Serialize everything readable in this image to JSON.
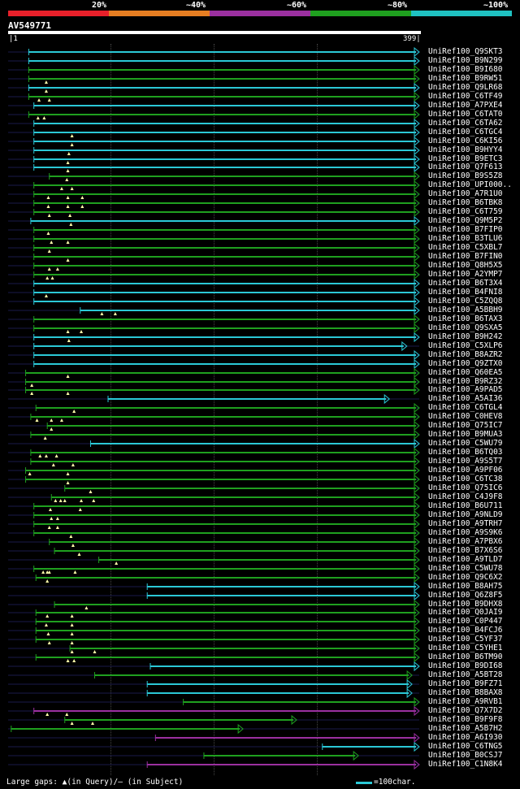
{
  "legend": [
    {
      "label": "20%",
      "color": "#e8202a"
    },
    {
      "label": "~40%",
      "color": "#e67e22"
    },
    {
      "label": "~60%",
      "color": "#9b30a0"
    },
    {
      "label": "~80%",
      "color": "#1fa01f"
    },
    {
      "label": "~100%",
      "color": "#1fc1c1"
    }
  ],
  "query": {
    "id": "AV549771",
    "start": "1",
    "end": "399"
  },
  "colors": {
    "cyan": "#2bc8d6",
    "green": "#1fa01f",
    "purple": "#9b30a0",
    "query_dim": "#1a1a4a",
    "gap_marker": "#ffffaa"
  },
  "hits": [
    {
      "label": "UniRef100_Q9SKT3",
      "color": "cyan",
      "start": 20,
      "end": 399,
      "qgap": []
    },
    {
      "label": "UniRef100_B9N299",
      "color": "cyan",
      "start": 20,
      "end": 399,
      "qgap": []
    },
    {
      "label": "UniRef100_B9I680",
      "color": "green",
      "start": 20,
      "end": 399,
      "qgap": []
    },
    {
      "label": "UniRef100_B9RW51",
      "color": "green",
      "start": 20,
      "end": 399,
      "qgap": [
        37
      ]
    },
    {
      "label": "UniRef100_Q9LR68",
      "color": "cyan",
      "start": 20,
      "end": 399,
      "qgap": [
        37
      ]
    },
    {
      "label": "UniRef100_C6TF49",
      "color": "green",
      "start": 20,
      "end": 399,
      "qgap": [
        30,
        40
      ]
    },
    {
      "label": "UniRef100_A7PXE4",
      "color": "cyan",
      "start": 25,
      "end": 399,
      "qgap": []
    },
    {
      "label": "UniRef100_C6TAT0",
      "color": "green",
      "start": 20,
      "end": 399,
      "qgap": [
        29,
        35
      ]
    },
    {
      "label": "UniRef100_C6TA62",
      "color": "cyan",
      "start": 25,
      "end": 399,
      "qgap": []
    },
    {
      "label": "UniRef100_C6TGC4",
      "color": "cyan",
      "start": 25,
      "end": 399,
      "qgap": [
        62
      ]
    },
    {
      "label": "UniRef100_C6KI56",
      "color": "cyan",
      "start": 25,
      "end": 399,
      "qgap": [
        62
      ]
    },
    {
      "label": "UniRef100_B9HYY4",
      "color": "cyan",
      "start": 25,
      "end": 399,
      "qgap": [
        59
      ]
    },
    {
      "label": "UniRef100_B9ETC3",
      "color": "cyan",
      "start": 25,
      "end": 399,
      "qgap": [
        58
      ]
    },
    {
      "label": "UniRef100_Q7F613",
      "color": "cyan",
      "start": 25,
      "end": 399,
      "qgap": [
        58
      ]
    },
    {
      "label": "UniRef100_B9S5Z8",
      "color": "green",
      "start": 40,
      "end": 399,
      "qgap": [
        57
      ]
    },
    {
      "label": "UniRef100_UPI000..",
      "color": "green",
      "start": 25,
      "end": 399,
      "qgap": [
        52,
        62
      ]
    },
    {
      "label": "UniRef100_A7R1U0",
      "color": "green",
      "start": 25,
      "end": 399,
      "qgap": [
        39,
        58,
        72
      ]
    },
    {
      "label": "UniRef100_B6TBK8",
      "color": "green",
      "start": 25,
      "end": 399,
      "qgap": [
        39,
        58,
        72
      ]
    },
    {
      "label": "UniRef100_C6T759",
      "color": "green",
      "start": 25,
      "end": 399,
      "qgap": [
        40,
        60
      ]
    },
    {
      "label": "UniRef100_Q9M5P2",
      "color": "cyan",
      "start": 22,
      "end": 399,
      "qgap": [
        61
      ]
    },
    {
      "label": "UniRef100_B7FIP0",
      "color": "green",
      "start": 25,
      "end": 399,
      "qgap": [
        39
      ]
    },
    {
      "label": "UniRef100_B3TLU6",
      "color": "green",
      "start": 25,
      "end": 399,
      "qgap": [
        42,
        58
      ]
    },
    {
      "label": "UniRef100_C5XBL7",
      "color": "green",
      "start": 25,
      "end": 399,
      "qgap": [
        40
      ]
    },
    {
      "label": "UniRef100_B7FIN0",
      "color": "green",
      "start": 25,
      "end": 399,
      "qgap": [
        58
      ]
    },
    {
      "label": "UniRef100_Q8H5X5",
      "color": "green",
      "start": 25,
      "end": 399,
      "qgap": [
        40,
        48
      ]
    },
    {
      "label": "UniRef100_A2YMP7",
      "color": "green",
      "start": 25,
      "end": 399,
      "qgap": [
        38,
        43
      ]
    },
    {
      "label": "UniRef100_B6T3X4",
      "color": "cyan",
      "start": 25,
      "end": 399,
      "qgap": []
    },
    {
      "label": "UniRef100_B4FNI8",
      "color": "cyan",
      "start": 25,
      "end": 399,
      "qgap": [
        37
      ]
    },
    {
      "label": "UniRef100_C5ZQQ8",
      "color": "cyan",
      "start": 25,
      "end": 399,
      "qgap": []
    },
    {
      "label": "UniRef100_A5BBH9",
      "color": "cyan",
      "start": 70,
      "end": 399,
      "qgap": [
        91,
        104
      ]
    },
    {
      "label": "UniRef100_B6TAX3",
      "color": "green",
      "start": 25,
      "end": 399,
      "qgap": []
    },
    {
      "label": "UniRef100_Q9SXA5",
      "color": "green",
      "start": 25,
      "end": 399,
      "qgap": [
        58,
        71
      ]
    },
    {
      "label": "UniRef100_B9H242",
      "color": "cyan",
      "start": 25,
      "end": 399,
      "qgap": [
        59
      ]
    },
    {
      "label": "UniRef100_C5XLP6",
      "color": "cyan",
      "start": 25,
      "end": 387,
      "qgap": []
    },
    {
      "label": "UniRef100_B8AZR2",
      "color": "cyan",
      "start": 25,
      "end": 399,
      "qgap": []
    },
    {
      "label": "UniRef100_Q9ZTX0",
      "color": "cyan",
      "start": 25,
      "end": 399,
      "qgap": []
    },
    {
      "label": "UniRef100_Q60EA5",
      "color": "green",
      "start": 17,
      "end": 399,
      "qgap": [
        58
      ]
    },
    {
      "label": "UniRef100_B9RZ32",
      "color": "green",
      "start": 17,
      "end": 399,
      "qgap": [
        23
      ]
    },
    {
      "label": "UniRef100_A9PAD5",
      "color": "green",
      "start": 17,
      "end": 399,
      "qgap": [
        23,
        58
      ]
    },
    {
      "label": "UniRef100_A5AI36",
      "color": "cyan",
      "start": 97,
      "end": 370,
      "qgap": []
    },
    {
      "label": "UniRef100_C6TGL4",
      "color": "green",
      "start": 27,
      "end": 399,
      "qgap": [
        64
      ]
    },
    {
      "label": "UniRef100_C0HEV8",
      "color": "green",
      "start": 22,
      "end": 399,
      "qgap": [
        28,
        42,
        52
      ]
    },
    {
      "label": "UniRef100_Q75IC7",
      "color": "green",
      "start": 38,
      "end": 399,
      "qgap": [
        42
      ]
    },
    {
      "label": "UniRef100_B9MUA3",
      "color": "green",
      "start": 22,
      "end": 399,
      "qgap": [
        36
      ]
    },
    {
      "label": "UniRef100_C5WU79",
      "color": "cyan",
      "start": 80,
      "end": 399,
      "qgap": []
    },
    {
      "label": "UniRef100_B6TQ03",
      "color": "green",
      "start": 22,
      "end": 399,
      "qgap": [
        31,
        37,
        47
      ]
    },
    {
      "label": "UniRef100_A9S5T7",
      "color": "green",
      "start": 22,
      "end": 399,
      "qgap": [
        44,
        63
      ]
    },
    {
      "label": "UniRef100_A9PF06",
      "color": "green",
      "start": 17,
      "end": 399,
      "qgap": [
        21,
        58
      ]
    },
    {
      "label": "UniRef100_C6TC38",
      "color": "green",
      "start": 17,
      "end": 399,
      "qgap": [
        58
      ]
    },
    {
      "label": "UniRef100_Q75IC6",
      "color": "green",
      "start": 55,
      "end": 399,
      "qgap": [
        80
      ]
    },
    {
      "label": "UniRef100_C4J9F8",
      "color": "green",
      "start": 42,
      "end": 399,
      "qgap": [
        46,
        51,
        55,
        71,
        83
      ]
    },
    {
      "label": "UniRef100_B6U711",
      "color": "green",
      "start": 25,
      "end": 399,
      "qgap": [
        41,
        70
      ]
    },
    {
      "label": "UniRef100_A9NLD9",
      "color": "green",
      "start": 25,
      "end": 399,
      "qgap": [
        42,
        48
      ]
    },
    {
      "label": "UniRef100_A9TRH7",
      "color": "green",
      "start": 25,
      "end": 399,
      "qgap": [
        40,
        48
      ]
    },
    {
      "label": "UniRef100_A9S9K6",
      "color": "green",
      "start": 25,
      "end": 399,
      "qgap": [
        61
      ]
    },
    {
      "label": "UniRef100_A7PBX6",
      "color": "green",
      "start": 40,
      "end": 399,
      "qgap": [
        63
      ]
    },
    {
      "label": "UniRef100_B7X6S6",
      "color": "green",
      "start": 45,
      "end": 399,
      "qgap": [
        69
      ]
    },
    {
      "label": "UniRef100_A9TLD7",
      "color": "green",
      "start": 88,
      "end": 399,
      "qgap": [
        105
      ]
    },
    {
      "label": "UniRef100_C5WU78",
      "color": "green",
      "start": 25,
      "end": 399,
      "qgap": [
        34,
        38,
        40,
        65
      ]
    },
    {
      "label": "UniRef100_Q9C6X2",
      "color": "green",
      "start": 27,
      "end": 399,
      "qgap": [
        38
      ]
    },
    {
      "label": "UniRef100_B8AH75",
      "color": "cyan",
      "start": 135,
      "end": 399,
      "qgap": []
    },
    {
      "label": "UniRef100_Q6Z8F5",
      "color": "cyan",
      "start": 135,
      "end": 399,
      "qgap": []
    },
    {
      "label": "UniRef100_B9DHX8",
      "color": "green",
      "start": 45,
      "end": 399,
      "qgap": [
        76
      ]
    },
    {
      "label": "UniRef100_Q0JAI9",
      "color": "green",
      "start": 27,
      "end": 399,
      "qgap": [
        38,
        62
      ]
    },
    {
      "label": "UniRef100_C0P447",
      "color": "green",
      "start": 27,
      "end": 399,
      "qgap": [
        37,
        62
      ]
    },
    {
      "label": "UniRef100_B4FCJ6",
      "color": "green",
      "start": 27,
      "end": 399,
      "qgap": [
        39,
        62
      ]
    },
    {
      "label": "UniRef100_C5YF37",
      "color": "green",
      "start": 27,
      "end": 399,
      "qgap": [
        40,
        62
      ]
    },
    {
      "label": "UniRef100_C5YHE1",
      "color": "green",
      "start": 60,
      "end": 399,
      "qgap": [
        62,
        84
      ]
    },
    {
      "label": "UniRef100_B6TM90",
      "color": "green",
      "start": 27,
      "end": 399,
      "qgap": [
        58,
        64
      ]
    },
    {
      "label": "UniRef100_B9DI68",
      "color": "cyan",
      "start": 138,
      "end": 399,
      "qgap": []
    },
    {
      "label": "UniRef100_A5BT28",
      "color": "green",
      "start": 84,
      "end": 392,
      "qgap": []
    },
    {
      "label": "UniRef100_B9FZ71",
      "color": "cyan",
      "start": 135,
      "end": 392,
      "qgap": []
    },
    {
      "label": "UniRef100_B8BAX8",
      "color": "cyan",
      "start": 135,
      "end": 392,
      "qgap": []
    },
    {
      "label": "UniRef100_A9RVB1",
      "color": "green",
      "start": 170,
      "end": 399,
      "qgap": []
    },
    {
      "label": "UniRef100_Q7X7D2",
      "color": "purple",
      "start": 25,
      "end": 399,
      "qgap": [
        38,
        57
      ]
    },
    {
      "label": "UniRef100_B9F9F8",
      "color": "green",
      "start": 55,
      "end": 280,
      "qgap": [
        62,
        82
      ]
    },
    {
      "label": "UniRef100_A5B7H2",
      "color": "green",
      "start": 3,
      "end": 228,
      "qgap": []
    },
    {
      "label": "UniRef100_A6I930",
      "color": "purple",
      "start": 143,
      "end": 399,
      "qgap": []
    },
    {
      "label": "UniRef100_C6TNG5",
      "color": "cyan",
      "start": 305,
      "end": 399,
      "qgap": []
    },
    {
      "label": "UniRef100_B0CSJ7",
      "color": "green",
      "start": 190,
      "end": 340,
      "qgap": []
    },
    {
      "label": "UniRef100_C1N8K4",
      "color": "purple",
      "start": 135,
      "end": 399,
      "qgap": []
    }
  ],
  "footer": {
    "text": "Large gaps: ▲(in Query)/– (in Subject)",
    "scale_label": "=100char."
  }
}
